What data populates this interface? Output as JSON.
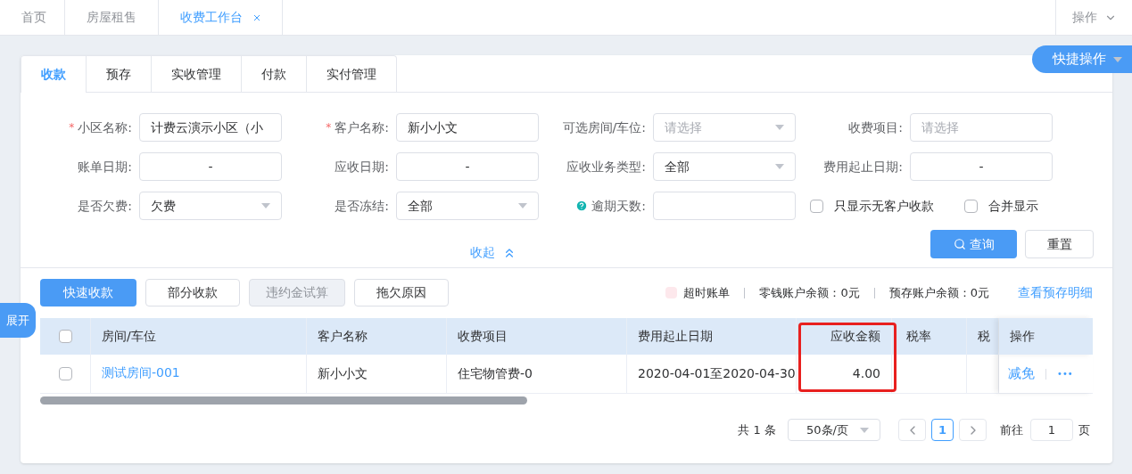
{
  "top_tabs": [
    {
      "label": "首页",
      "selected": false,
      "closable": false
    },
    {
      "label": "房屋租售",
      "selected": false,
      "closable": false
    },
    {
      "label": "收费工作台",
      "selected": true,
      "closable": true
    }
  ],
  "top_menu": {
    "label": "操作"
  },
  "quick_actions": {
    "label": "快捷操作"
  },
  "expand_tab": {
    "label": "展开"
  },
  "card_tabs": [
    {
      "label": "收款",
      "selected": true
    },
    {
      "label": "预存",
      "selected": false
    },
    {
      "label": "实收管理",
      "selected": false
    },
    {
      "label": "付款",
      "selected": false
    },
    {
      "label": "实付管理",
      "selected": false
    }
  ],
  "form_fields": [
    {
      "label": "小区名称:",
      "kind": "text",
      "required_mark": "*",
      "value": "计费云演示小区（小"
    },
    {
      "label": "客户名称:",
      "kind": "text",
      "required_mark": "*",
      "value": "新小小文"
    },
    {
      "label": "可选房间/车位:",
      "kind": "select",
      "placeholder": "请选择"
    },
    {
      "label": "收费项目:",
      "kind": "text",
      "placeholder": "请选择"
    },
    {
      "label": "账单日期:",
      "kind": "date",
      "value": "-"
    },
    {
      "label": "应收日期:",
      "kind": "date",
      "value": "-"
    },
    {
      "label": "应收业务类型:",
      "kind": "select",
      "value": "全部"
    },
    {
      "label": "费用起止日期:",
      "kind": "date",
      "value": "-"
    },
    {
      "label": "是否欠费:",
      "kind": "select",
      "value": "欠费"
    },
    {
      "label": "是否冻结:",
      "kind": "select",
      "value": "全部"
    },
    {
      "label": "逾期天数:",
      "kind": "help"
    }
  ],
  "form_checkboxes": [
    {
      "label": "只显示无客户收款",
      "checked": false
    },
    {
      "label": "合并显示",
      "checked": false
    }
  ],
  "collapse_link": {
    "label": "收起"
  },
  "search_button": {
    "label": "查询"
  },
  "reset_button": {
    "label": "重置"
  },
  "toolbar_buttons": [
    {
      "label": "快速收款",
      "kind": "primary",
      "disabled": false
    },
    {
      "label": "部分收款",
      "kind": "default",
      "disabled": false
    },
    {
      "label": "违约金试算",
      "kind": "default",
      "disabled": true
    },
    {
      "label": "拖欠原因",
      "kind": "default",
      "disabled": false
    }
  ],
  "legend": {
    "label": "超时账单",
    "color": "#fde8ec"
  },
  "balances": [
    "零钱账户余额：0元",
    "预存账户余额：0元"
  ],
  "detail_link": "查看预存明细",
  "table": {
    "select_all_checked": false,
    "columns": [
      {
        "label": "房间/车位",
        "kind": "text",
        "highlighted": false
      },
      {
        "label": "客户名称",
        "kind": "text",
        "highlighted": false
      },
      {
        "label": "收费项目",
        "kind": "text",
        "highlighted": false
      },
      {
        "label": "费用起止日期",
        "kind": "text",
        "highlighted": false
      },
      {
        "label": "应收金额",
        "kind": "amount",
        "highlighted": true
      },
      {
        "label": "税率",
        "kind": "text",
        "highlighted": false
      },
      {
        "label": "税",
        "kind": "text",
        "highlighted": false
      },
      {
        "label": "操作",
        "kind": "text",
        "highlighted": false
      }
    ],
    "rows": [
      {
        "checked": false,
        "cells": [
          {
            "kind": "link",
            "text": "测试房间-001"
          },
          {
            "kind": "text",
            "text": "新小小文"
          },
          {
            "kind": "text",
            "text": "住宅物管费-0"
          },
          {
            "kind": "text",
            "text": "2020-04-01至2020-04-30"
          },
          {
            "kind": "text",
            "text": "4.00"
          },
          {
            "kind": "empty"
          },
          {
            "kind": "empty"
          }
        ],
        "actions": [
          "减免",
          "•••"
        ]
      }
    ]
  },
  "pagination": {
    "total": "共 1 条",
    "page_size": "50条/页",
    "pages": [
      {
        "label": "1",
        "selected": true
      }
    ],
    "goto_label": "前往",
    "goto_value": "1",
    "page_suffix": "页"
  }
}
